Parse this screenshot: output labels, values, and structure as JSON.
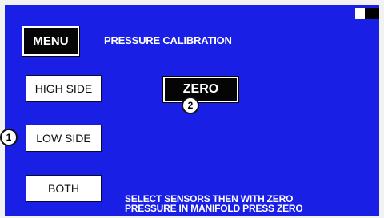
{
  "header": {
    "menu_label": "MENU",
    "title": "PRESSURE CALIBRATION"
  },
  "sensors": {
    "high_label": "HIGH SIDE",
    "low_label": "LOW SIDE",
    "both_label": "BOTH"
  },
  "actions": {
    "zero_label": "ZERO"
  },
  "instructions": {
    "line1": "SELECT SENSORS THEN WITH ZERO",
    "line2": "PRESSURE IN MANIFOLD PRESS ZERO"
  },
  "callouts": {
    "one": "1",
    "two": "2"
  },
  "colors": {
    "screen_bg": "#1a1fe6",
    "button_bg": "#ffffff",
    "dark_button_bg": "#050505"
  },
  "icons": {
    "status": "battery-indicator-icon"
  }
}
